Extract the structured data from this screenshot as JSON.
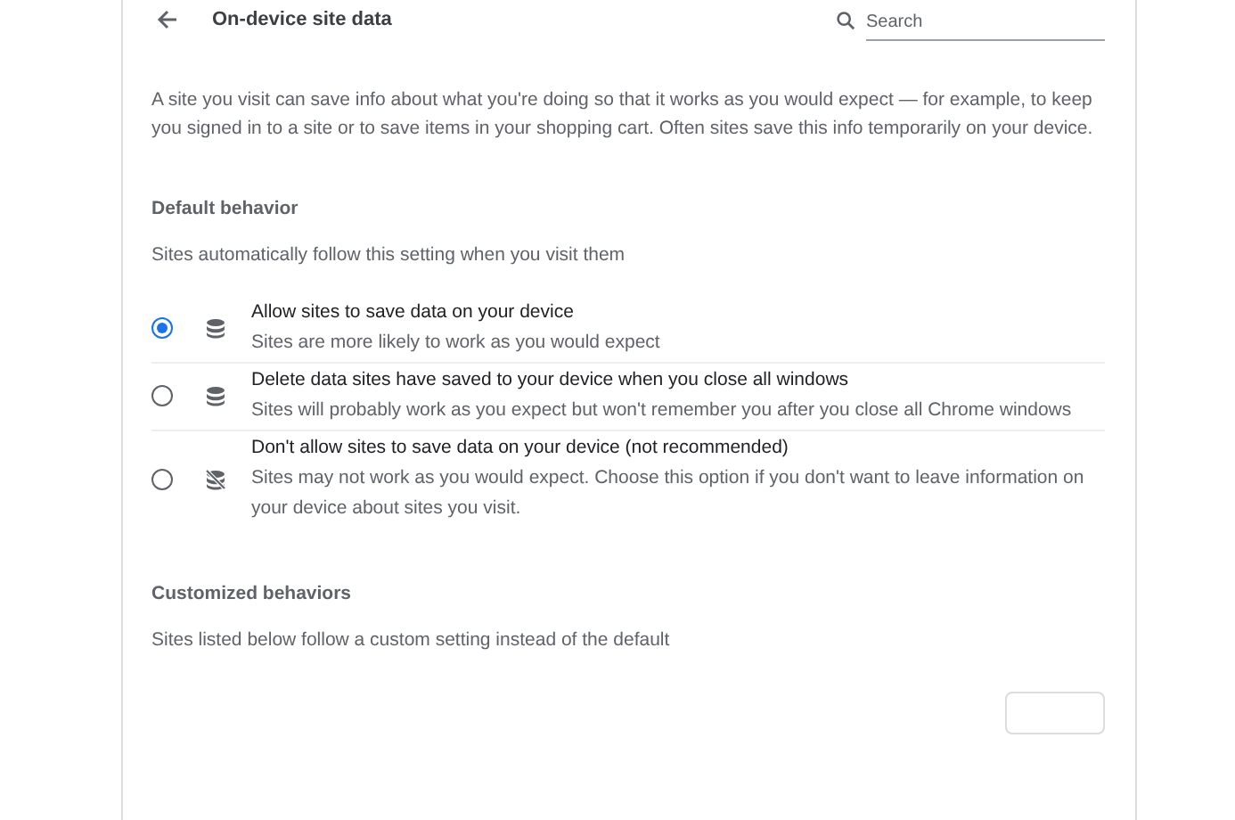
{
  "header": {
    "title": "On-device site data",
    "search": {
      "placeholder": "Search"
    }
  },
  "description": "A site you visit can save info about what you're doing so that it works as you would expect — for example, to keep you signed in to a site or to save items in your shopping cart. Often sites save this info temporarily on your device.",
  "default_behavior": {
    "heading": "Default behavior",
    "subtitle": "Sites automatically follow this setting when you visit them",
    "options": [
      {
        "kind": "allow",
        "label": "Allow sites to save data on your device",
        "description": "Sites are more likely to work as you would expect",
        "selected": true
      },
      {
        "kind": "allow",
        "label": "Delete data sites have saved to your device when you close all windows",
        "description": "Sites will probably work as you expect but won't remember you after you close all Chrome windows",
        "selected": false
      },
      {
        "kind": "block",
        "label": "Don't allow sites to save data on your device (not recommended)",
        "description": "Sites may not work as you would expect. Choose this option if you don't want to leave information on your device about sites you visit.",
        "selected": false
      }
    ]
  },
  "customized_behaviors": {
    "heading": "Customized behaviors",
    "subtitle": "Sites listed below follow a custom setting instead of the default"
  }
}
